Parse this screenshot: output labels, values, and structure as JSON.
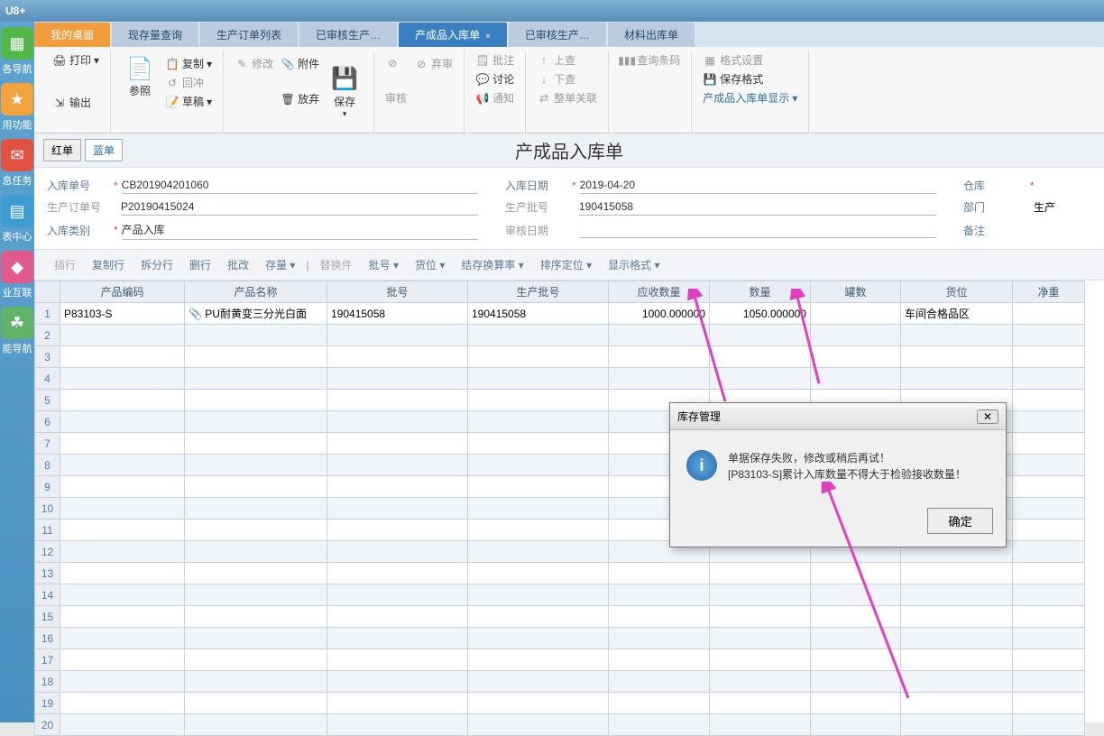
{
  "app_title": "U8+",
  "sidebar": {
    "items": [
      {
        "label": "各导航",
        "color": "#51b749"
      },
      {
        "label": "用功能",
        "color": "#f2a33c"
      },
      {
        "label": "息任务",
        "color": "#e15241"
      },
      {
        "label": "表中心",
        "color": "#3c9dd0"
      },
      {
        "label": "业互联",
        "color": "#e05a8a"
      },
      {
        "label": "能导航",
        "color": "#62b36a"
      }
    ]
  },
  "tabs": {
    "items": [
      {
        "label": "我的桌面"
      },
      {
        "label": "现存量查询"
      },
      {
        "label": "生产订单列表"
      },
      {
        "label": "已审核生产…"
      },
      {
        "label": "产成品入库单",
        "active": true,
        "closable": true
      },
      {
        "label": "已审核生产…"
      },
      {
        "label": "材料出库单"
      }
    ]
  },
  "ribbon": {
    "print": "打印",
    "output": "输出",
    "reference": "参照",
    "copy": "复制",
    "hedge": "回冲",
    "draft": "草稿",
    "modify": "修改",
    "attach": "附件",
    "abandon": "放弃",
    "save": "保存",
    "abandonReview": "弃审",
    "review": "审核",
    "annotate": "批注",
    "discuss": "讨论",
    "notify": "通知",
    "upload": "上查",
    "download": "下查",
    "wholeRelation": "整单关联",
    "queryBarcode": "查询条码",
    "formatSet": "格式设置",
    "saveFormat": "保存格式",
    "displayMode": "产成品入库单显示"
  },
  "form_toggle": {
    "red": "红单",
    "blue": "蓝单"
  },
  "doc_title": "产成品入库单",
  "fields": {
    "doc_no_lbl": "入库单号",
    "doc_no": "CB201904201060",
    "in_date_lbl": "入库日期",
    "in_date": "2019-04-20",
    "warehouse_lbl": "仓库",
    "prod_order_lbl": "生产订单号",
    "prod_order": "P20190415024",
    "prod_batch_lbl": "生产批号",
    "prod_batch": "190415058",
    "dept_lbl": "部门",
    "dept_val": "生产",
    "category_lbl": "入库类别",
    "category": "产品入库",
    "audit_date_lbl": "审核日期",
    "audit_date": "",
    "remark_lbl": "备注"
  },
  "grid_toolbar": {
    "insert": "插行",
    "copyrow": "复制行",
    "splitrow": "拆分行",
    "delrow": "删行",
    "batch_mod": "批改",
    "stock": "存量",
    "replace": "替换件",
    "batchno": "批号",
    "slot": "货位",
    "convert": "结存换算率",
    "sort": "排序定位",
    "display": "显示格式"
  },
  "columns": {
    "code": "产品编码",
    "name": "产品名称",
    "batch": "批号",
    "prod_batch": "生产批号",
    "yingshou": "应收数量",
    "qty": "数量",
    "cans": "罐数",
    "slot": "货位",
    "netwt": "净重"
  },
  "rows": [
    {
      "code": "P83103-S",
      "name": "PU耐黄变三分光白面",
      "batch": "190415058",
      "prod_batch": "190415058",
      "yingshou": "1000.000000",
      "qty": "1050.000000",
      "cans": "",
      "slot": "车间合格品区"
    }
  ],
  "dialog": {
    "title": "库存管理",
    "msg1": "单据保存失败，修改或稍后再试！",
    "msg2": "[P83103-S]累计入库数量不得大于检验接收数量！",
    "ok": "确定"
  }
}
